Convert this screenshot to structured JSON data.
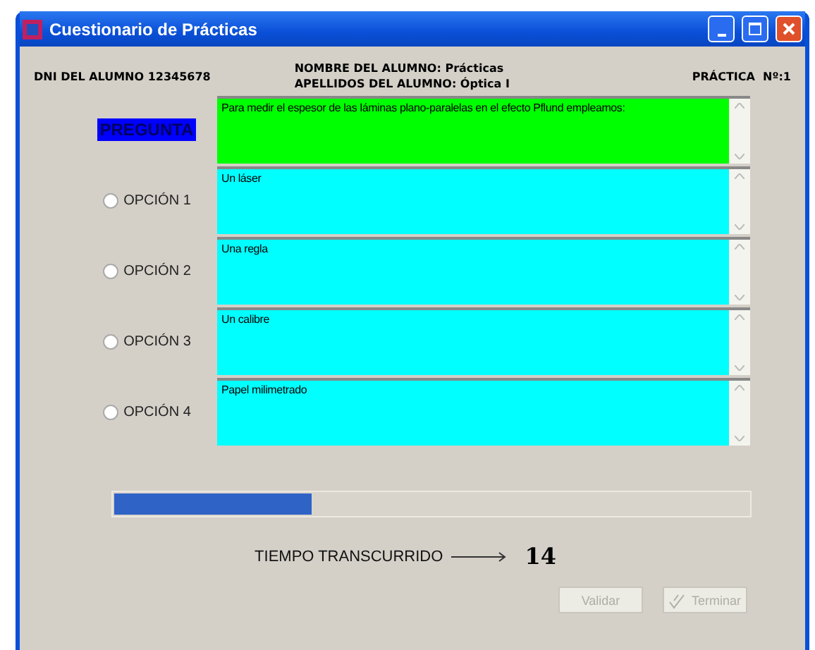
{
  "window": {
    "title": "Cuestionario de Prácticas"
  },
  "header": {
    "dni": "DNI DEL ALUMNO 12345678",
    "nombre": "NOMBRE DEL ALUMNO: Prácticas",
    "apellidos": "APELLIDOS DEL ALUMNO: Óptica I",
    "practica": "PRÁCTICA  Nº:1"
  },
  "question": {
    "label": "PREGUNTA",
    "text": "Para medir el espesor de las láminas plano-paralelas en el efecto Pflund empleamos:"
  },
  "options": [
    {
      "label": "OPCIÓN 1",
      "text": "Un láser",
      "selected": false
    },
    {
      "label": "OPCIÓN 2",
      "text": "Una regla",
      "selected": false
    },
    {
      "label": "OPCIÓN 3",
      "text": "Un calibre",
      "selected": false
    },
    {
      "label": "OPCIÓN 4",
      "text": "Papel milimetrado",
      "selected": false
    }
  ],
  "progress": {
    "level": 0.31
  },
  "timer": {
    "label": "TIEMPO TRANSCURRIDO",
    "value": "14"
  },
  "buttons": [
    {
      "label": "Validar",
      "disabled": true,
      "kind": "plain"
    },
    {
      "label": "Terminar",
      "disabled": true,
      "kind": "icon"
    }
  ]
}
